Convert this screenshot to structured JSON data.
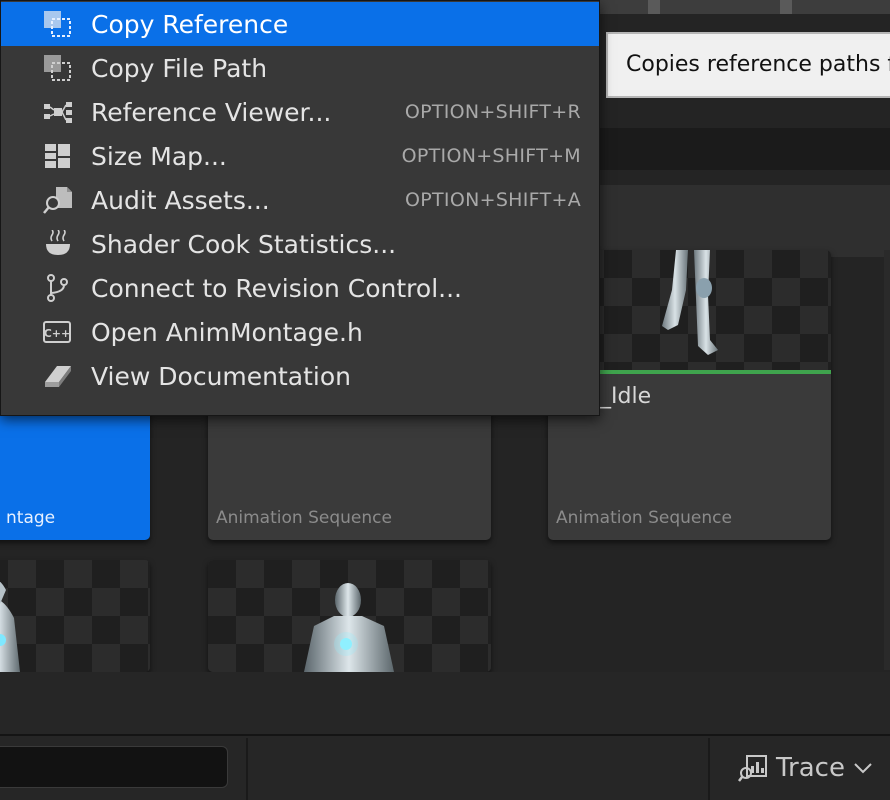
{
  "context_menu": {
    "items": [
      {
        "label": "Copy Reference",
        "shortcut": "",
        "icon": "copy-reference-icon",
        "highlighted": true
      },
      {
        "label": "Copy File Path",
        "shortcut": "",
        "icon": "copy-file-path-icon"
      },
      {
        "label": "Reference Viewer...",
        "shortcut": "OPTION+SHIFT+R",
        "icon": "reference-viewer-icon"
      },
      {
        "label": "Size Map...",
        "shortcut": "OPTION+SHIFT+M",
        "icon": "size-map-icon"
      },
      {
        "label": "Audit Assets...",
        "shortcut": "OPTION+SHIFT+A",
        "icon": "audit-assets-icon"
      },
      {
        "label": "Shader Cook Statistics...",
        "shortcut": "",
        "icon": "shader-cook-icon"
      },
      {
        "label": "Connect to Revision Control...",
        "shortcut": "",
        "icon": "revision-control-icon"
      },
      {
        "label": "Open AnimMontage.h",
        "shortcut": "",
        "icon": "cpp-header-icon"
      },
      {
        "label": "View Documentation",
        "shortcut": "",
        "icon": "documentation-icon"
      }
    ]
  },
  "tooltip": {
    "text": "Copies reference paths f"
  },
  "asset_grid": {
    "tiles": [
      {
        "type_label": "ntage",
        "selected": true
      },
      {
        "type_label": "Animation Sequence",
        "selected": false
      },
      {
        "name": "_Idle",
        "type_label": "Animation Sequence",
        "selected": false
      }
    ]
  },
  "status_bar": {
    "trace_label": "Trace"
  },
  "colors": {
    "selection_blue": "#0a70e8",
    "menu_bg": "#383838",
    "tile_bg": "#3a3a3a",
    "accent_green": "#3fa34d"
  }
}
